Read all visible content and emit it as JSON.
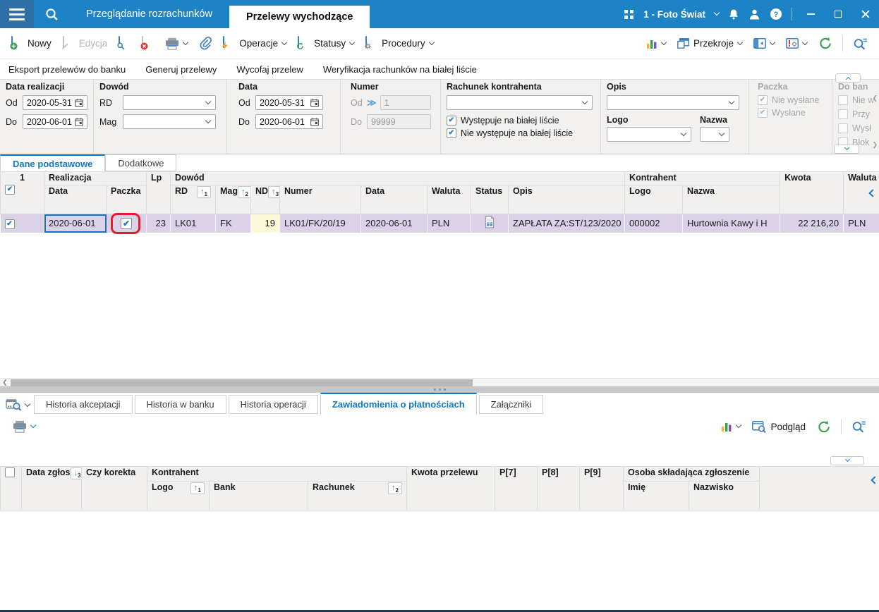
{
  "colors": {
    "titlebar_blue": "#1c83c6",
    "hamburger_blue": "#2d6fa6",
    "accent_blue": "#1079c2",
    "row_highlight": "#dcd2e8",
    "cell_yellow": "#fbf8d9",
    "annotation_red": "#e11d2e",
    "sort_green": "#2e9e4f",
    "refresh_green": "#35a14e"
  },
  "icons": [
    "hamburger-icon",
    "search-icon",
    "apps-grid-icon",
    "chevron-down-icon",
    "bell-icon",
    "user-icon",
    "help-icon",
    "minimize-icon",
    "maximize-icon",
    "close-icon",
    "new-doc-icon",
    "edit-pencil-icon",
    "preview-doc-icon",
    "delete-doc-icon",
    "printer-icon",
    "paperclip-icon",
    "lightning-doc-icon",
    "refresh-doc-icon",
    "gear-doc-icon",
    "bar-chart-icon",
    "cascade-windows-icon",
    "dock-panel-icon",
    "validation-gear-icon",
    "refresh-icon",
    "search-plus-icon",
    "calendar-icon",
    "double-chevron-icon",
    "status-document-icon",
    "sort-asc-icon",
    "sort-desc-icon",
    "panel-search-icon",
    "window-magnifier-icon"
  ],
  "titlebar": {
    "tab1": "Przeglądanie rozrachunków",
    "tab2": "Przelewy wychodzące",
    "company": "1 - Foto Świat"
  },
  "toolbar": {
    "nowy": "Nowy",
    "edycja": "Edycja",
    "operacje": "Operacje",
    "statusy": "Statusy",
    "procedury": "Procedury",
    "przekroje": "Przekroje"
  },
  "action_links": [
    "Eksport przelewów do banku",
    "Generuj przelewy",
    "Wycofaj przelew",
    "Weryfikacja rachunków na białej liście"
  ],
  "filters": {
    "data_realizacji": {
      "title": "Data realizacji",
      "od": "Od",
      "do": "Do",
      "od_value": "2020-05-31",
      "do_value": "2020-06-01"
    },
    "dowod": {
      "title": "Dowód",
      "rd": "RD",
      "mag": "Mag"
    },
    "data": {
      "title": "Data",
      "od": "Od",
      "do": "Do",
      "od_value": "2020-05-31",
      "do_value": "2020-06-01"
    },
    "numer": {
      "title": "Numer",
      "od": "Od",
      "do": "Do",
      "od_value": "1",
      "do_value": "99999"
    },
    "rachunek": {
      "title": "Rachunek kontrahenta",
      "check1": "Występuje na białej liście",
      "check2": "Nie występuje na białej liście"
    },
    "opis": {
      "title": "Opis"
    },
    "logo": {
      "title": "Logo"
    },
    "nazwa": {
      "title": "Nazwa"
    },
    "paczka": {
      "title": "Paczka",
      "check1": "Nie wysłane",
      "check2": "Wysłane"
    },
    "do_banku": {
      "title": "Do ban",
      "check1": "Nie w",
      "check2": "Przy",
      "check3": "Wysł",
      "check4": "Blok"
    }
  },
  "view_tabs": {
    "tab1": "Dane podstawowe",
    "tab2": "Dodatkowe"
  },
  "grid": {
    "groups": {
      "realizacja": "Realizacja",
      "dowod": "Dowód",
      "kontrahent": "Kontrahent"
    },
    "header": {
      "sel": "1",
      "data": "Data",
      "paczka": "Paczka",
      "lp": "Lp",
      "rd": "RD",
      "mag": "Mag",
      "nd": "ND",
      "numer": "Numer",
      "data2": "Data",
      "waluta": "Waluta",
      "status": "Status",
      "opis": "Opis",
      "logo": "Logo",
      "nazwa": "Nazwa",
      "kwota": "Kwota",
      "waluta2": "Waluta"
    },
    "sort": {
      "rd": "1",
      "mag": "2",
      "nd": "3"
    },
    "row": {
      "data": "2020-06-01",
      "lp": "23",
      "rd": "LK01",
      "mag": "FK",
      "nd": "19",
      "numer": "LK01/FK/20/19",
      "data2": "2020-06-01",
      "waluta": "PLN",
      "opis": "ZAPŁATA ZA:ST/123/2020",
      "logo": "000002",
      "nazwa": "Hurtownia Kawy i H",
      "kwota": "22 216,20",
      "waluta2": "PLN"
    }
  },
  "bottom_tabs": {
    "tab1": "Historia akceptacji",
    "tab2": "Historia w banku",
    "tab3": "Historia operacji",
    "tab4": "Zawiadomienia o płatnościach",
    "tab5": "Załączniki"
  },
  "bottom_toolbar": {
    "podglad": "Podgląd"
  },
  "bottom_grid": {
    "header": {
      "data_zglos": "Data zgłos",
      "czy_korekta": "Czy korekta",
      "kontrahent": "Kontrahent",
      "logo": "Logo",
      "bank": "Bank",
      "rachunek": "Rachunek",
      "kwota_przelewu": "Kwota przelewu",
      "p7": "P[7]",
      "p8": "P[8]",
      "p9": "P[9]",
      "osoba": "Osoba składająca zgłoszenie",
      "imie": "Imię",
      "nazwisko": "Nazwisko"
    },
    "sort": {
      "data_zglos": "3",
      "logo": "1",
      "rachunek": "2"
    }
  }
}
